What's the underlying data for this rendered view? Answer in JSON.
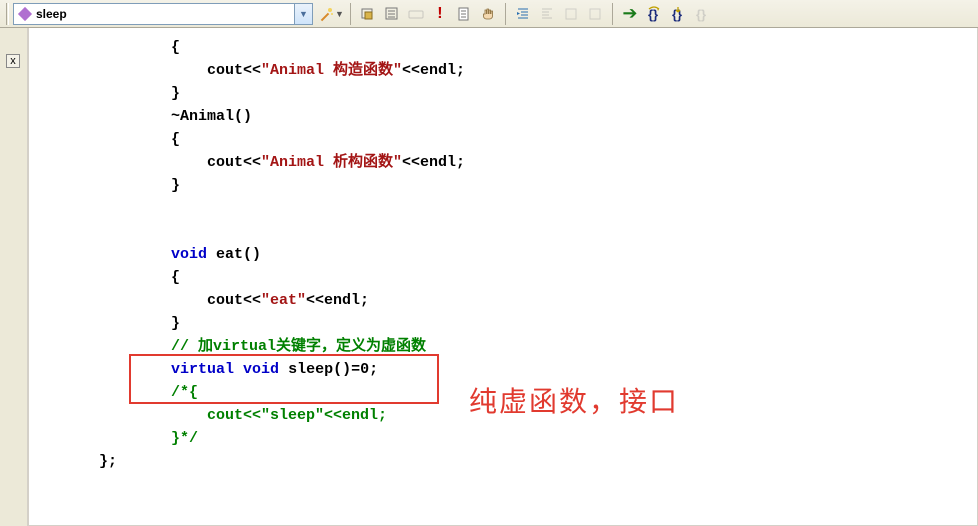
{
  "toolbar": {
    "combo_value": "sleep",
    "icons": {
      "magic": "magic-wand-icon",
      "down": "chevron-down-icon",
      "bp_toggle": "breakpoint-toggle-icon",
      "bp_list": "breakpoint-list-icon",
      "bp_clear": "breakpoint-clear-icon",
      "exclaim": "exclaim-icon",
      "doc": "document-icon",
      "hand": "hand-icon",
      "indent_inc": "indent-increase-icon",
      "indent_dec": "indent-decrease-icon",
      "indent_a": "indent-a-icon",
      "indent_b": "indent-b-icon",
      "arrow": "run-arrow-icon",
      "step_over": "step-over-icon",
      "step_into": "step-into-icon",
      "step_out": "step-out-icon"
    }
  },
  "code": {
    "l01": "        {",
    "l02_a": "            cout<<",
    "l02_b": "\"Animal 构造函数\"",
    "l02_c": "<<endl;",
    "l03": "        }",
    "l04": "        ~Animal()",
    "l05": "        {",
    "l06_a": "            cout<<",
    "l06_b": "\"Animal 析构函数\"",
    "l06_c": "<<endl;",
    "l07": "        }",
    "l08": "",
    "l09": "",
    "l10_a": "        ",
    "l10_kw": "void",
    "l10_b": " eat()",
    "l11": "        {",
    "l12_a": "            cout<<",
    "l12_b": "\"eat\"",
    "l12_c": "<<endl;",
    "l13": "        }",
    "l14_cm": "        // 加virtual关键字，定义为虚函数",
    "l15_a": "        ",
    "l15_kw1": "virtual",
    "l15_b": " ",
    "l15_kw2": "void",
    "l15_c": " sleep()=",
    "l15_num": "0",
    "l15_d": ";",
    "l16_cm": "        /*{",
    "l17_cm": "            cout<<\"sleep\"<<endl;",
    "l18_cm": "        }*/",
    "l19": "};"
  },
  "annotation": "纯虚函数，接口",
  "gutter": {
    "close": "x"
  }
}
